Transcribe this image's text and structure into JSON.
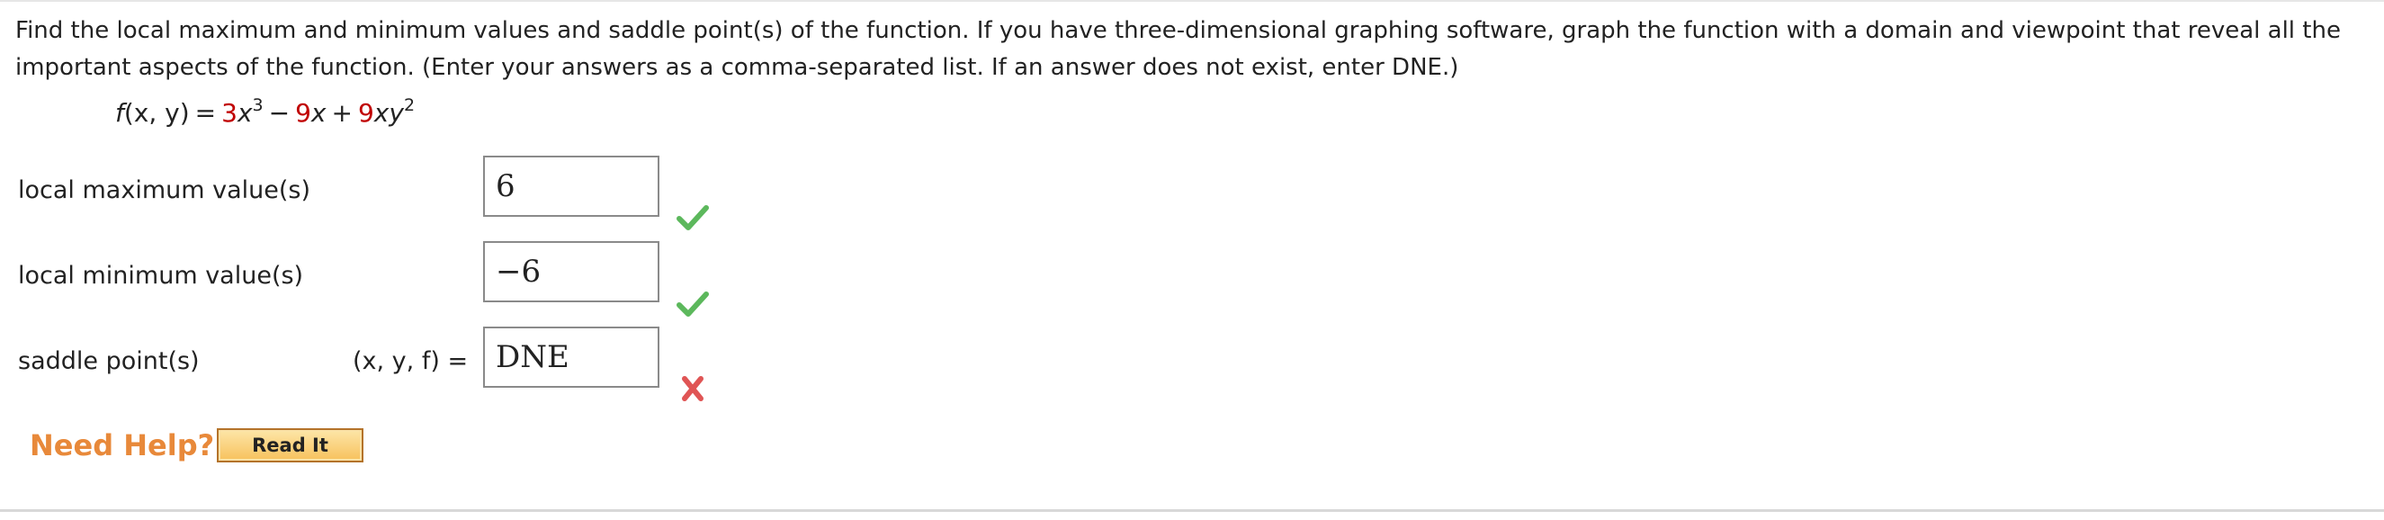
{
  "question": {
    "text": "Find the local maximum and minimum values and saddle point(s) of the function. If you have three-dimensional graphing software, graph the function with a domain and viewpoint that reveal all the important aspects of the function. (Enter your answers as a comma-separated list. If an answer does not exist, enter DNE.)"
  },
  "formula": {
    "fn": "f",
    "args": "(x, y)",
    "equals": "=",
    "c1": "3",
    "t1": "x",
    "e1": "3",
    "minus": "−",
    "c2": "9",
    "t2": "x",
    "plus": "+",
    "c3": "9",
    "t3": "xy",
    "e3": "2",
    "coefficient_color": "#c00000"
  },
  "rows": [
    {
      "label": "local maximum value(s)",
      "answer": "6",
      "status": "correct",
      "status_icon": "checkmark-icon"
    },
    {
      "label": "local minimum value(s)",
      "answer": "−6",
      "status": "correct",
      "status_icon": "checkmark-icon"
    },
    {
      "label": "saddle point(s)",
      "prefix": "(x, y, f) =",
      "answer": "DNE",
      "status": "incorrect",
      "status_icon": "cross-icon"
    }
  ],
  "help": {
    "label": "Need Help?",
    "button_label": "Read It"
  },
  "colors": {
    "correct": "#5cb85c",
    "incorrect": "#e05555",
    "help": "#e8893a"
  }
}
